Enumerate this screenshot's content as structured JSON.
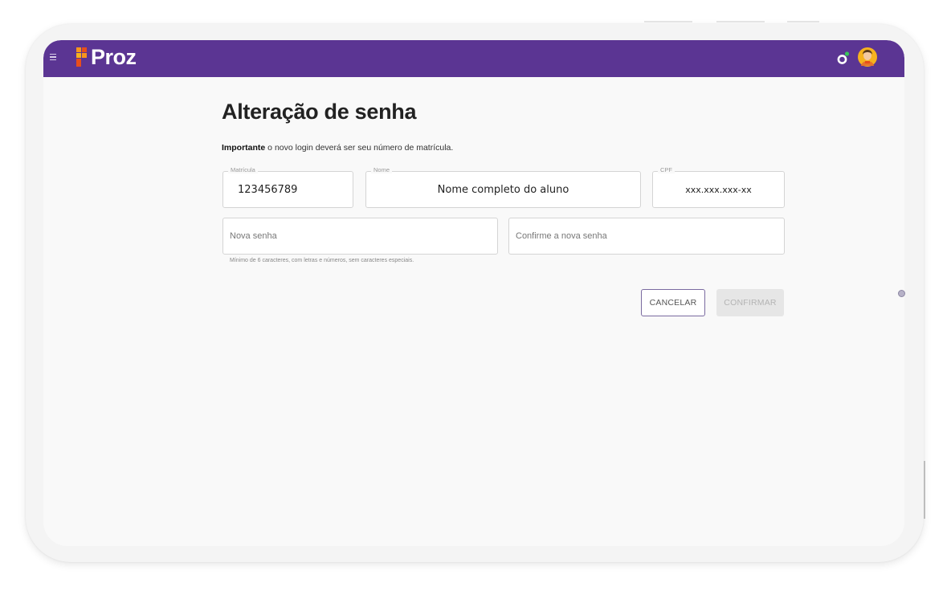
{
  "header": {
    "brand": "Proz",
    "menu_icon": "hamburger-menu-icon",
    "notification_icon": "notification-badge-icon",
    "avatar_icon": "user-avatar-icon",
    "brand_color": "#5b3593"
  },
  "page": {
    "title": "Alteração de senha",
    "notice_strong": "Importante",
    "notice_text": " o novo login deverá ser seu número de matrícula."
  },
  "form": {
    "matricula": {
      "label": "Matrícula",
      "value": "123456789"
    },
    "nome": {
      "label": "Nome",
      "value": "Nome completo do aluno"
    },
    "cpf": {
      "label": "CPF",
      "value": "xxx.xxx.xxx-xx"
    },
    "nova_senha": {
      "placeholder": "Nova senha"
    },
    "confirmar_senha": {
      "placeholder": "Confirme a nova senha"
    },
    "helper": "Mínimo de 6 caracteres, com letras e números, sem caracteres especiais."
  },
  "actions": {
    "cancel_label": "CANCELAR",
    "confirm_label": "CONFIRMAR"
  }
}
